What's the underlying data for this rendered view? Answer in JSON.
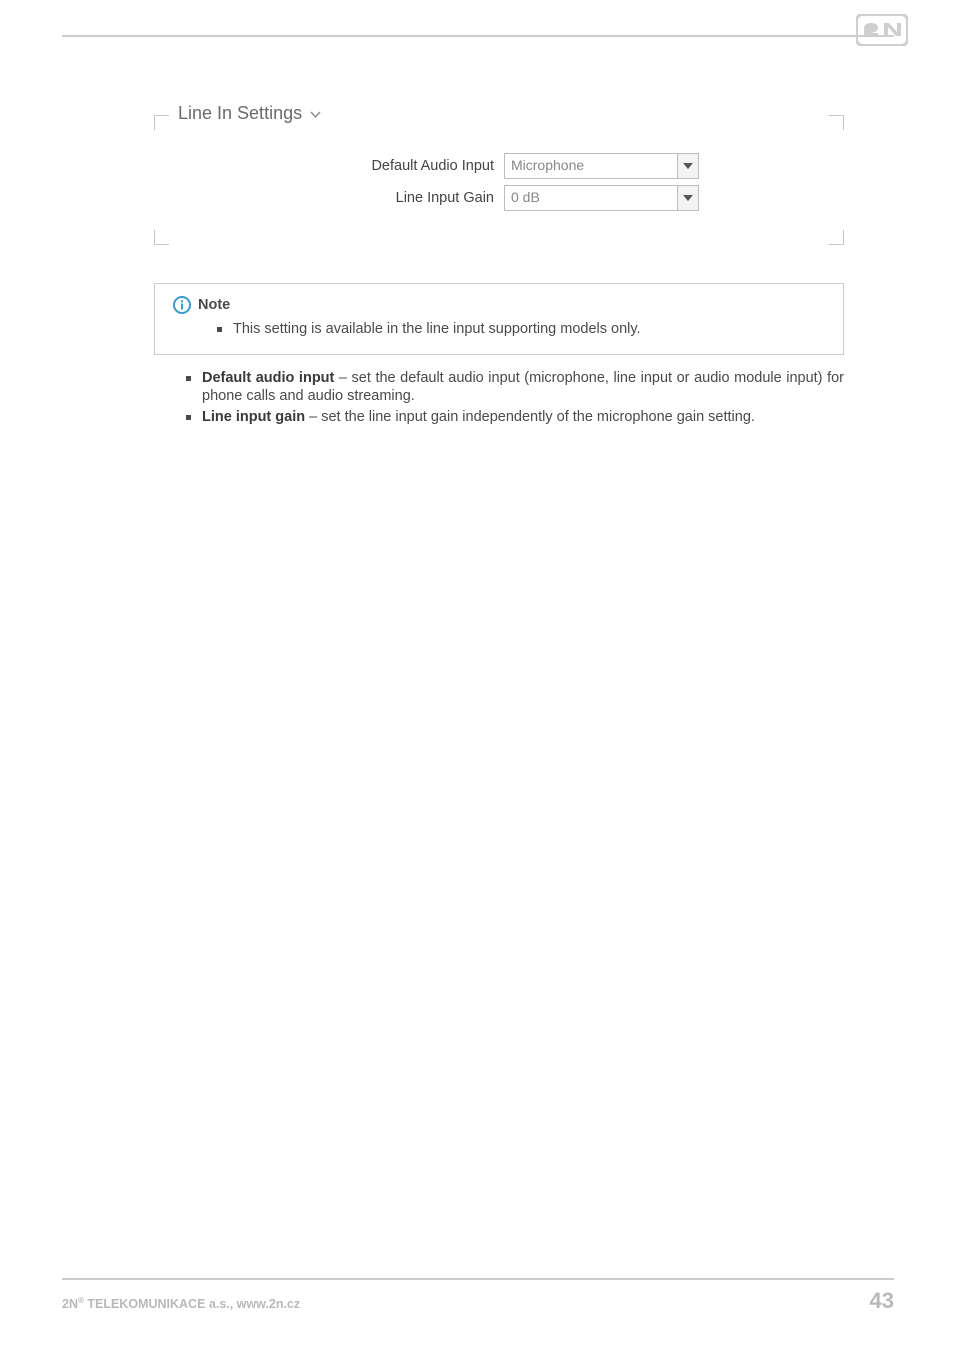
{
  "fieldset": {
    "legend": "Line In Settings",
    "rows": [
      {
        "label": "Default Audio Input",
        "value": "Microphone"
      },
      {
        "label": "Line Input Gain",
        "value": "0 dB"
      }
    ]
  },
  "note": {
    "title": "Note",
    "items": [
      "This setting is available in the line input supporting models only."
    ]
  },
  "body_items": [
    {
      "term": "Default audio input",
      "rest": " – set the default audio input (microphone, line input or audio module input) for phone calls and audio streaming."
    },
    {
      "term": "Line input gain",
      "rest": " – set the line input gain independently of the microphone gain setting."
    }
  ],
  "footer": {
    "left_prefix": "2N",
    "left_sup": "®",
    "left_rest": " TELEKOMUNIKACE a.s., www.2n.cz",
    "page": "43"
  }
}
